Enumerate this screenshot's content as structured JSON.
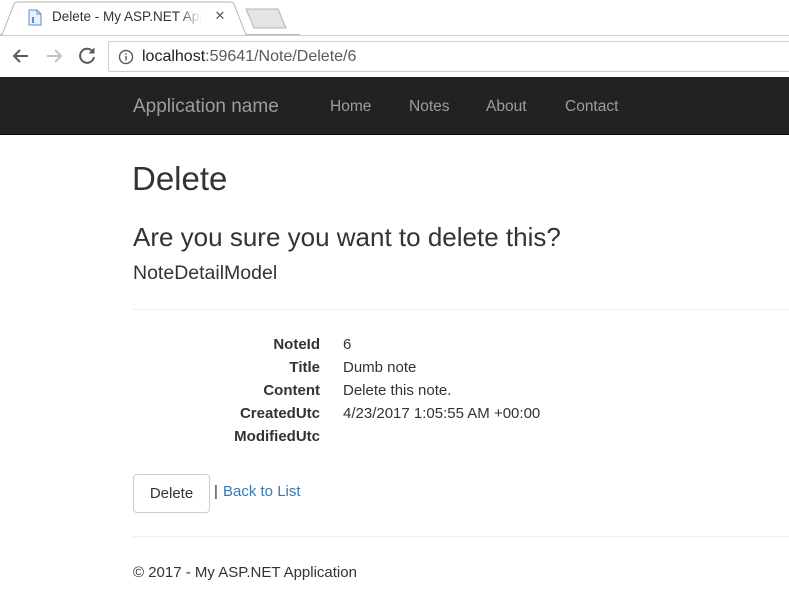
{
  "browser": {
    "tab_title": "Delete - My ASP.NET Application",
    "close_glyph": "✕",
    "url_host": "localhost",
    "url_path": ":59641/Note/Delete/6"
  },
  "navbar": {
    "brand": "Application name",
    "links": [
      "Home",
      "Notes",
      "About",
      "Contact"
    ]
  },
  "page": {
    "title": "Delete",
    "question": "Are you sure you want to delete this?",
    "model_name": "NoteDetailModel",
    "details": [
      {
        "term": "NoteId",
        "value": "6"
      },
      {
        "term": "Title",
        "value": "Dumb note"
      },
      {
        "term": "Content",
        "value": "Delete this note."
      },
      {
        "term": "CreatedUtc",
        "value": "4/23/2017 1:05:55 AM +00:00"
      },
      {
        "term": "ModifiedUtc",
        "value": ""
      }
    ],
    "delete_button": "Delete",
    "separator": "|",
    "back_link": "Back to List"
  },
  "footer": {
    "text": "© 2017 - My ASP.NET Application"
  },
  "colors": {
    "navbar_bg": "#222222",
    "navbar_text": "#9d9d9d",
    "link": "#337ab7"
  }
}
